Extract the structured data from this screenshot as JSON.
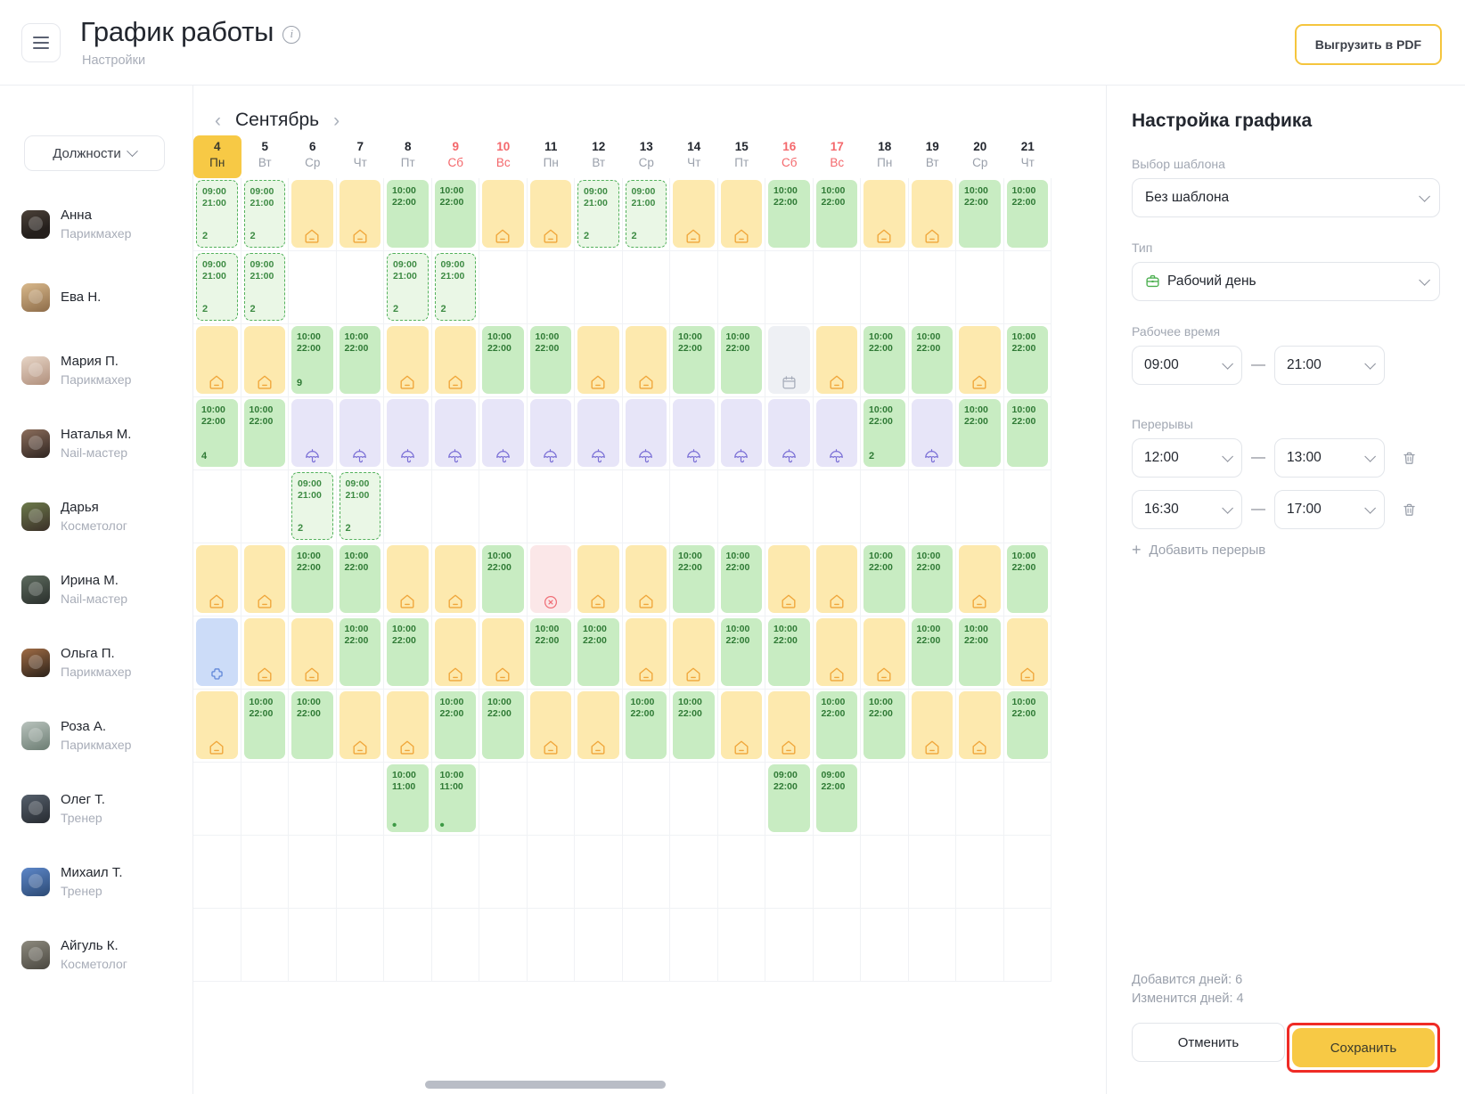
{
  "header": {
    "menu_icon": "hamburger-icon",
    "title": "График работы",
    "info_icon": "info-icon",
    "subtitle": "Настройки",
    "pdf_button": "Выгрузить в PDF"
  },
  "staff_panel": {
    "positions_button": "Должности",
    "chevron_icon": "chevron-down-icon",
    "employees": [
      {
        "name": "Анна",
        "position": "Парикмахер"
      },
      {
        "name": "Ева Н.",
        "position": ""
      },
      {
        "name": "Мария П.",
        "position": "Парикмахер"
      },
      {
        "name": "Наталья М.",
        "position": "Nail-мастер"
      },
      {
        "name": "Дарья",
        "position": "Косметолог"
      },
      {
        "name": "Ирина М.",
        "position": "Nail-мастер"
      },
      {
        "name": "Ольга П.",
        "position": "Парикмахер"
      },
      {
        "name": "Роза А.",
        "position": "Парикмахер"
      },
      {
        "name": "Олег Т.",
        "position": "Тренер"
      },
      {
        "name": "Михаил Т.",
        "position": "Тренер"
      },
      {
        "name": "Айгуль К.",
        "position": "Косметолог"
      }
    ]
  },
  "calendar": {
    "prev_icon": "chevron-left-icon",
    "next_icon": "chevron-right-icon",
    "month": "Сентябрь",
    "days": [
      {
        "num": "4",
        "wd": "Пн",
        "weekend": false,
        "today": true
      },
      {
        "num": "5",
        "wd": "Вт",
        "weekend": false,
        "today": false
      },
      {
        "num": "6",
        "wd": "Ср",
        "weekend": false,
        "today": false
      },
      {
        "num": "7",
        "wd": "Чт",
        "weekend": false,
        "today": false
      },
      {
        "num": "8",
        "wd": "Пт",
        "weekend": false,
        "today": false
      },
      {
        "num": "9",
        "wd": "Сб",
        "weekend": true,
        "today": false
      },
      {
        "num": "10",
        "wd": "Вс",
        "weekend": true,
        "today": false
      },
      {
        "num": "11",
        "wd": "Пн",
        "weekend": false,
        "today": false
      },
      {
        "num": "12",
        "wd": "Вт",
        "weekend": false,
        "today": false
      },
      {
        "num": "13",
        "wd": "Ср",
        "weekend": false,
        "today": false
      },
      {
        "num": "14",
        "wd": "Чт",
        "weekend": false,
        "today": false
      },
      {
        "num": "15",
        "wd": "Пт",
        "weekend": false,
        "today": false
      },
      {
        "num": "16",
        "wd": "Сб",
        "weekend": true,
        "today": false
      },
      {
        "num": "17",
        "wd": "Вс",
        "weekend": true,
        "today": false
      },
      {
        "num": "18",
        "wd": "Пн",
        "weekend": false,
        "today": false
      },
      {
        "num": "19",
        "wd": "Вт",
        "weekend": false,
        "today": false
      },
      {
        "num": "20",
        "wd": "Ср",
        "weekend": false,
        "today": false
      },
      {
        "num": "21",
        "wd": "Чт",
        "weekend": false,
        "today": false
      }
    ],
    "legend": {
      "green": "Рабочий день",
      "green_dashed": "Новый рабочий день",
      "yellow_house": "Выходной",
      "purple_umbrella": "Отпуск",
      "pink_cross": "Больничный",
      "blue_cross": "Больничный",
      "gray_calendar": "Другое"
    },
    "rows": [
      [
        {
          "t": "green-dash",
          "times": "09:00\n21:00",
          "count": "2"
        },
        {
          "t": "green-dash",
          "times": "09:00\n21:00",
          "count": "2"
        },
        {
          "t": "yellow",
          "icon": "house-icon"
        },
        {
          "t": "yellow",
          "icon": "house-icon"
        },
        {
          "t": "green",
          "times": "10:00\n22:00"
        },
        {
          "t": "green",
          "times": "10:00\n22:00"
        },
        {
          "t": "yellow",
          "icon": "house-icon"
        },
        {
          "t": "yellow",
          "icon": "house-icon"
        },
        {
          "t": "green-dash",
          "times": "09:00\n21:00",
          "count": "2"
        },
        {
          "t": "green-dash",
          "times": "09:00\n21:00",
          "count": "2"
        },
        {
          "t": "yellow",
          "icon": "house-icon"
        },
        {
          "t": "yellow",
          "icon": "house-icon"
        },
        {
          "t": "green",
          "times": "10:00\n22:00"
        },
        {
          "t": "green",
          "times": "10:00\n22:00"
        },
        {
          "t": "yellow",
          "icon": "house-icon"
        },
        {
          "t": "yellow",
          "icon": "house-icon"
        },
        {
          "t": "green",
          "times": "10:00\n22:00"
        },
        {
          "t": "green",
          "times": "10:00\n22:00"
        }
      ],
      [
        {
          "t": "green-dash",
          "times": "09:00\n21:00",
          "count": "2"
        },
        {
          "t": "green-dash",
          "times": "09:00\n21:00",
          "count": "2"
        },
        {
          "t": "empty"
        },
        {
          "t": "empty"
        },
        {
          "t": "green-dash",
          "times": "09:00\n21:00",
          "count": "2"
        },
        {
          "t": "green-dash",
          "times": "09:00\n21:00",
          "count": "2"
        },
        {
          "t": "empty"
        },
        {
          "t": "empty"
        },
        {
          "t": "empty"
        },
        {
          "t": "empty"
        },
        {
          "t": "empty"
        },
        {
          "t": "empty"
        },
        {
          "t": "empty"
        },
        {
          "t": "empty"
        },
        {
          "t": "empty"
        },
        {
          "t": "empty"
        },
        {
          "t": "empty"
        },
        {
          "t": "empty"
        }
      ],
      [
        {
          "t": "yellow",
          "icon": "house-icon"
        },
        {
          "t": "yellow",
          "icon": "house-icon"
        },
        {
          "t": "green",
          "times": "10:00\n22:00",
          "count": "9"
        },
        {
          "t": "green",
          "times": "10:00\n22:00"
        },
        {
          "t": "yellow",
          "icon": "house-icon"
        },
        {
          "t": "yellow",
          "icon": "house-icon"
        },
        {
          "t": "green",
          "times": "10:00\n22:00"
        },
        {
          "t": "green",
          "times": "10:00\n22:00"
        },
        {
          "t": "yellow",
          "icon": "house-icon"
        },
        {
          "t": "yellow",
          "icon": "house-icon"
        },
        {
          "t": "green",
          "times": "10:00\n22:00"
        },
        {
          "t": "green",
          "times": "10:00\n22:00"
        },
        {
          "t": "gray",
          "icon": "calendar-icon"
        },
        {
          "t": "yellow",
          "icon": "house-icon"
        },
        {
          "t": "green",
          "times": "10:00\n22:00"
        },
        {
          "t": "green",
          "times": "10:00\n22:00"
        },
        {
          "t": "yellow",
          "icon": "house-icon"
        },
        {
          "t": "green",
          "times": "10:00\n22:00"
        }
      ],
      [
        {
          "t": "green",
          "times": "10:00\n22:00",
          "count": "4"
        },
        {
          "t": "green",
          "times": "10:00\n22:00"
        },
        {
          "t": "purple",
          "icon": "umbrella-icon"
        },
        {
          "t": "purple",
          "icon": "umbrella-icon"
        },
        {
          "t": "purple",
          "icon": "umbrella-icon"
        },
        {
          "t": "purple",
          "icon": "umbrella-icon"
        },
        {
          "t": "purple",
          "icon": "umbrella-icon"
        },
        {
          "t": "purple",
          "icon": "umbrella-icon"
        },
        {
          "t": "purple",
          "icon": "umbrella-icon"
        },
        {
          "t": "purple",
          "icon": "umbrella-icon"
        },
        {
          "t": "purple",
          "icon": "umbrella-icon"
        },
        {
          "t": "purple",
          "icon": "umbrella-icon"
        },
        {
          "t": "purple",
          "icon": "umbrella-icon"
        },
        {
          "t": "purple",
          "icon": "umbrella-icon"
        },
        {
          "t": "green",
          "times": "10:00\n22:00",
          "count": "2"
        },
        {
          "t": "purple",
          "icon": "umbrella-icon"
        },
        {
          "t": "green",
          "times": "10:00\n22:00"
        },
        {
          "t": "green",
          "times": "10:00\n22:00"
        }
      ],
      [
        {
          "t": "empty"
        },
        {
          "t": "empty"
        },
        {
          "t": "green-dash",
          "times": "09:00\n21:00",
          "count": "2"
        },
        {
          "t": "green-dash",
          "times": "09:00\n21:00",
          "count": "2"
        },
        {
          "t": "empty"
        },
        {
          "t": "empty"
        },
        {
          "t": "empty"
        },
        {
          "t": "empty"
        },
        {
          "t": "empty"
        },
        {
          "t": "empty"
        },
        {
          "t": "empty"
        },
        {
          "t": "empty"
        },
        {
          "t": "empty"
        },
        {
          "t": "empty"
        },
        {
          "t": "empty"
        },
        {
          "t": "empty"
        },
        {
          "t": "empty"
        },
        {
          "t": "empty"
        }
      ],
      [
        {
          "t": "yellow",
          "icon": "house-icon"
        },
        {
          "t": "yellow",
          "icon": "house-icon"
        },
        {
          "t": "green",
          "times": "10:00\n22:00"
        },
        {
          "t": "green",
          "times": "10:00\n22:00"
        },
        {
          "t": "yellow",
          "icon": "house-icon"
        },
        {
          "t": "yellow",
          "icon": "house-icon"
        },
        {
          "t": "green",
          "times": "10:00\n22:00"
        },
        {
          "t": "pink",
          "icon": "circle-x-icon"
        },
        {
          "t": "yellow",
          "icon": "house-icon"
        },
        {
          "t": "yellow",
          "icon": "house-icon"
        },
        {
          "t": "green",
          "times": "10:00\n22:00"
        },
        {
          "t": "green",
          "times": "10:00\n22:00"
        },
        {
          "t": "yellow",
          "icon": "house-icon"
        },
        {
          "t": "yellow",
          "icon": "house-icon"
        },
        {
          "t": "green",
          "times": "10:00\n22:00"
        },
        {
          "t": "green",
          "times": "10:00\n22:00"
        },
        {
          "t": "yellow",
          "icon": "house-icon"
        },
        {
          "t": "green",
          "times": "10:00\n22:00"
        }
      ],
      [
        {
          "t": "blue",
          "icon": "medical-cross-icon"
        },
        {
          "t": "yellow",
          "icon": "house-icon"
        },
        {
          "t": "yellow",
          "icon": "house-icon"
        },
        {
          "t": "green",
          "times": "10:00\n22:00"
        },
        {
          "t": "green",
          "times": "10:00\n22:00"
        },
        {
          "t": "yellow",
          "icon": "house-icon"
        },
        {
          "t": "yellow",
          "icon": "house-icon"
        },
        {
          "t": "green",
          "times": "10:00\n22:00"
        },
        {
          "t": "green",
          "times": "10:00\n22:00"
        },
        {
          "t": "yellow",
          "icon": "house-icon"
        },
        {
          "t": "yellow",
          "icon": "house-icon"
        },
        {
          "t": "green",
          "times": "10:00\n22:00"
        },
        {
          "t": "green",
          "times": "10:00\n22:00"
        },
        {
          "t": "yellow",
          "icon": "house-icon"
        },
        {
          "t": "yellow",
          "icon": "house-icon"
        },
        {
          "t": "green",
          "times": "10:00\n22:00"
        },
        {
          "t": "green",
          "times": "10:00\n22:00"
        },
        {
          "t": "yellow",
          "icon": "house-icon"
        }
      ],
      [
        {
          "t": "yellow",
          "icon": "house-icon"
        },
        {
          "t": "green",
          "times": "10:00\n22:00"
        },
        {
          "t": "green",
          "times": "10:00\n22:00"
        },
        {
          "t": "yellow",
          "icon": "house-icon"
        },
        {
          "t": "yellow",
          "icon": "house-icon"
        },
        {
          "t": "green",
          "times": "10:00\n22:00"
        },
        {
          "t": "green",
          "times": "10:00\n22:00"
        },
        {
          "t": "yellow",
          "icon": "house-icon"
        },
        {
          "t": "yellow",
          "icon": "house-icon"
        },
        {
          "t": "green",
          "times": "10:00\n22:00"
        },
        {
          "t": "green",
          "times": "10:00\n22:00"
        },
        {
          "t": "yellow",
          "icon": "house-icon"
        },
        {
          "t": "yellow",
          "icon": "house-icon"
        },
        {
          "t": "green",
          "times": "10:00\n22:00"
        },
        {
          "t": "green",
          "times": "10:00\n22:00"
        },
        {
          "t": "yellow",
          "icon": "house-icon"
        },
        {
          "t": "yellow",
          "icon": "house-icon"
        },
        {
          "t": "green",
          "times": "10:00\n22:00"
        }
      ],
      [
        {
          "t": "empty"
        },
        {
          "t": "empty"
        },
        {
          "t": "empty"
        },
        {
          "t": "empty"
        },
        {
          "t": "green",
          "times": "10:00\n11:00",
          "dot": true
        },
        {
          "t": "green",
          "times": "10:00\n11:00",
          "dot": true
        },
        {
          "t": "empty"
        },
        {
          "t": "empty"
        },
        {
          "t": "empty"
        },
        {
          "t": "empty"
        },
        {
          "t": "empty"
        },
        {
          "t": "empty"
        },
        {
          "t": "green",
          "times": "09:00\n22:00"
        },
        {
          "t": "green",
          "times": "09:00\n22:00"
        },
        {
          "t": "empty"
        },
        {
          "t": "empty"
        },
        {
          "t": "empty"
        },
        {
          "t": "empty"
        }
      ],
      [
        {
          "t": "empty"
        },
        {
          "t": "empty"
        },
        {
          "t": "empty"
        },
        {
          "t": "empty"
        },
        {
          "t": "empty"
        },
        {
          "t": "empty"
        },
        {
          "t": "empty"
        },
        {
          "t": "empty"
        },
        {
          "t": "empty"
        },
        {
          "t": "empty"
        },
        {
          "t": "empty"
        },
        {
          "t": "empty"
        },
        {
          "t": "empty"
        },
        {
          "t": "empty"
        },
        {
          "t": "empty"
        },
        {
          "t": "empty"
        },
        {
          "t": "empty"
        },
        {
          "t": "empty"
        }
      ],
      [
        {
          "t": "empty"
        },
        {
          "t": "empty"
        },
        {
          "t": "empty"
        },
        {
          "t": "empty"
        },
        {
          "t": "empty"
        },
        {
          "t": "empty"
        },
        {
          "t": "empty"
        },
        {
          "t": "empty"
        },
        {
          "t": "empty"
        },
        {
          "t": "empty"
        },
        {
          "t": "empty"
        },
        {
          "t": "empty"
        },
        {
          "t": "empty"
        },
        {
          "t": "empty"
        },
        {
          "t": "empty"
        },
        {
          "t": "empty"
        },
        {
          "t": "empty"
        },
        {
          "t": "empty"
        }
      ]
    ]
  },
  "settings": {
    "heading": "Настройка графика",
    "template_label": "Выбор шаблона",
    "template_value": "Без шаблона",
    "type_label": "Тип",
    "type_value": "Рабочий день",
    "type_icon": "briefcase-icon",
    "worktime_label": "Рабочее время",
    "work_from": "09:00",
    "work_to": "21:00",
    "breaks_label": "Перерывы",
    "breaks": [
      {
        "from": "12:00",
        "to": "13:00",
        "delete_icon": "trash-icon"
      },
      {
        "from": "16:30",
        "to": "17:00",
        "delete_icon": "trash-icon"
      }
    ],
    "add_break": "Добавить перерыв",
    "summary_added": "Добавится дней: 6",
    "summary_changed": "Изменится дней: 4",
    "cancel_button": "Отменить",
    "save_button": "Сохранить"
  },
  "colors": {
    "accent_yellow": "#f7c945",
    "green": "#c8ecc2",
    "green_text": "#2f7a35",
    "yellow_chip": "#fde9ae",
    "purple_chip": "#e7e5f8",
    "pink_chip": "#fbe7e8",
    "blue_chip": "#ccdcf8",
    "weekend_red": "#f4686c",
    "highlight_red": "#ef2b25"
  }
}
